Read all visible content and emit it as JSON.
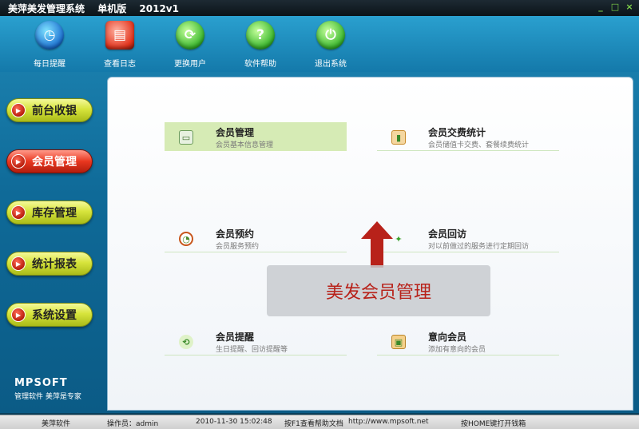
{
  "window": {
    "title_app": "美萍美发管理系统",
    "title_edition": "单机版",
    "title_version": "2012v1",
    "btn_min": "_",
    "btn_max": "□",
    "btn_close": "×"
  },
  "toolbar": [
    {
      "label": "每日提醒",
      "icon": "clock-icon",
      "glyph": "◷"
    },
    {
      "label": "查看日志",
      "icon": "log-icon",
      "glyph": "▤"
    },
    {
      "label": "更换用户",
      "icon": "switch-user-icon",
      "glyph": "⟳"
    },
    {
      "label": "软件帮助",
      "icon": "help-icon",
      "glyph": "?"
    },
    {
      "label": "退出系统",
      "icon": "power-icon",
      "glyph": "⏻"
    }
  ],
  "nav": [
    {
      "label": "前台收银",
      "active": false
    },
    {
      "label": "会员管理",
      "active": true
    },
    {
      "label": "库存管理",
      "active": false
    },
    {
      "label": "统计报表",
      "active": false
    },
    {
      "label": "系统设置",
      "active": false
    }
  ],
  "brand": {
    "logo": "MPSOFT",
    "slogan": "管理软件  美萍是专家"
  },
  "items": [
    {
      "title": "会员管理",
      "sub": "会员基本信息管理",
      "icon": "member-card-icon",
      "glyph": "▭"
    },
    {
      "title": "会员交费统计",
      "sub": "会员储值卡交费、套餐续费统计",
      "icon": "stats-icon",
      "glyph": "▮"
    },
    {
      "title": "会员预约",
      "sub": "会员服务预约",
      "icon": "appointment-clock-icon",
      "glyph": "◔"
    },
    {
      "title": "会员回访",
      "sub": "对以前做过的服务进行定期回访",
      "icon": "revisit-icon",
      "glyph": "✦"
    },
    {
      "title": "会员提醒",
      "sub": "生日提醒、回访提醒等",
      "icon": "reminder-icon",
      "glyph": "⟲"
    },
    {
      "title": "意向会员",
      "sub": "添加有意向的会员",
      "icon": "prospect-icon",
      "glyph": "▣"
    }
  ],
  "overlay": {
    "caption": "美发会员管理"
  },
  "status": {
    "company": "美萍软件",
    "operator": "操作员：admin",
    "datetime": "2010-11-30 15:02:48",
    "help": "按F1查看帮助文档",
    "url": "http://www.mpsoft.net",
    "hint": "按HOME键打开钱箱"
  },
  "colors": {
    "accent_red": "#e2341d",
    "nav_yellow": "#d7e43c",
    "selected_row": "#d6ebb5"
  }
}
